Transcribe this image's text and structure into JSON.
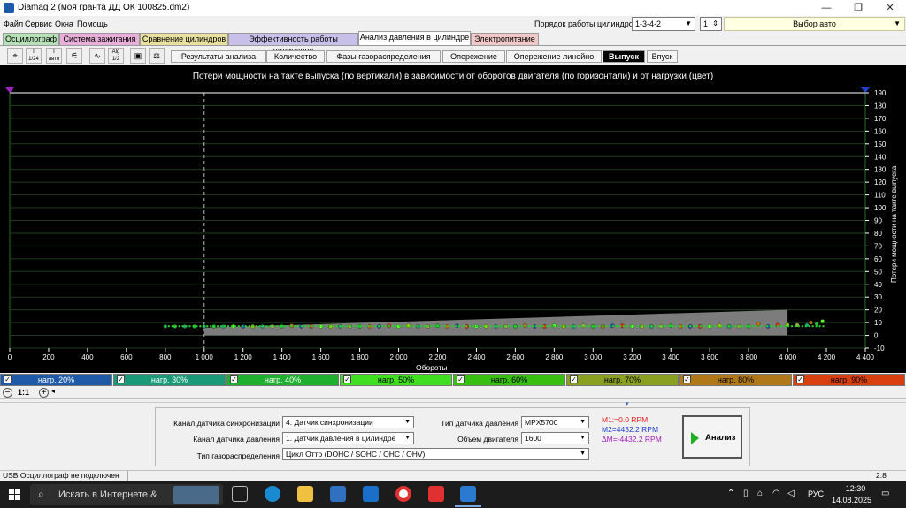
{
  "window": {
    "title": "Diamag 2 (моя гранта ДД ОК 100825.dm2)",
    "minimize": "—",
    "maximize": "❐",
    "close": "✕"
  },
  "menu": [
    "Файл",
    "Сервис",
    "Окна",
    "Помощь"
  ],
  "cylinder_order": {
    "label": "Порядок работы цилиндров",
    "value": "1-3-4-2",
    "cyl": "1"
  },
  "auto_select": "Выбор авто",
  "main_tabs": [
    {
      "label": "Осциллограф",
      "color": "#b8e0b8"
    },
    {
      "label": "Система зажигания",
      "color": "#e8b0d8"
    },
    {
      "label": "Сравнение цилиндров",
      "color": "#e8e0a0"
    },
    {
      "label": "Эффективность работы цилиндров",
      "color": "#c8c0e8"
    },
    {
      "label": "Анализ давления в цилиндре",
      "color": "#ffffff"
    },
    {
      "label": "Электропитание",
      "color": "#f0c8c8"
    }
  ],
  "sub_tabs": [
    "Результаты анализа",
    "Количество",
    "Фазы газораспределения",
    "Опережение",
    "Опережение линейно",
    "Выпуск",
    "Впуск"
  ],
  "sub_tab_active": "Выпуск",
  "chart_data": {
    "type": "scatter",
    "title": "Потери мощности на такте выпуска (по вертикали) в зависимости от оборотов двигателя (по горизонтали) и от нагрузки (цвет)",
    "xlabel": "Обороты",
    "ylabel": "Потери мощности на такте выпуска",
    "xlim": [
      0,
      4400
    ],
    "ylim": [
      -10,
      190
    ],
    "x_ticks": [
      "0",
      "200",
      "400",
      "600",
      "800",
      "1 000",
      "1 200",
      "1 400",
      "1 600",
      "1 800",
      "2 000",
      "2 200",
      "2 400",
      "2 600",
      "2 800",
      "3 000",
      "3 200",
      "3 400",
      "3 600",
      "3 800",
      "4 000",
      "4 200",
      "4 400"
    ],
    "y_ticks": [
      "-10",
      "0",
      "10",
      "20",
      "30",
      "40",
      "50",
      "60",
      "70",
      "80",
      "90",
      "100",
      "110",
      "120",
      "130",
      "140",
      "150",
      "160",
      "170",
      "180",
      "190"
    ],
    "cursor_x": 1000,
    "band": {
      "x": [
        1000,
        4000
      ],
      "y_low": [
        0,
        0
      ],
      "y_high": [
        6,
        20
      ],
      "color": "#8a8a8a"
    },
    "series": [
      {
        "name": "нагр. 20%",
        "color": "#1e5aa8",
        "x": [
          1200,
          1500,
          1900,
          2300,
          2700,
          3100,
          3500,
          3900
        ],
        "y": [
          7,
          7,
          7,
          7.5,
          7,
          7.5,
          7,
          7
        ]
      },
      {
        "name": "нагр. 30%",
        "color": "#20a070",
        "x": [
          800,
          900,
          1000,
          1100,
          1300,
          1700,
          2100,
          2500,
          2900,
          3300,
          3700,
          4100
        ],
        "y": [
          7,
          7,
          7,
          7,
          7,
          7,
          7,
          7,
          7,
          7,
          7,
          8
        ]
      },
      {
        "name": "нагр. 40%",
        "color": "#20c030",
        "x": [
          850,
          950,
          1050,
          1400,
          1800,
          2200,
          2600,
          3000,
          3400,
          3800,
          4150
        ],
        "y": [
          7,
          7,
          7,
          7,
          7,
          7.5,
          7,
          7,
          7.5,
          7,
          9
        ]
      },
      {
        "name": "нагр. 50%",
        "color": "#60ff30",
        "x": [
          1150,
          1600,
          2000,
          2400,
          2800,
          3200,
          3600,
          4180
        ],
        "y": [
          7,
          7,
          7,
          7,
          7.5,
          7,
          7,
          11
        ]
      },
      {
        "name": "нагр. 60%",
        "color": "#a0d000",
        "x": [
          1250,
          1650,
          2050,
          2450,
          2850,
          3250,
          3650,
          4000
        ],
        "y": [
          7,
          7,
          7.5,
          7,
          7,
          7,
          7.5,
          8
        ]
      },
      {
        "name": "нагр. 70%",
        "color": "#a0b040",
        "x": [
          1350,
          1750,
          2150,
          2550,
          2950,
          3350,
          3750,
          4050
        ],
        "y": [
          7,
          7,
          7,
          7,
          7.5,
          7,
          7,
          8
        ]
      },
      {
        "name": "нагр. 80%",
        "color": "#c07010",
        "x": [
          1450,
          1850,
          2250,
          2650,
          3050,
          3450,
          3850,
          4120
        ],
        "y": [
          7.5,
          7,
          7,
          7.5,
          7,
          7,
          9,
          10
        ]
      },
      {
        "name": "нагр. 90%",
        "color": "#e03010",
        "x": [
          1550,
          1950,
          2350,
          2750,
          3150,
          3550,
          3950
        ],
        "y": [
          7,
          7.5,
          7,
          7,
          7.5,
          7,
          8
        ]
      }
    ]
  },
  "loads": [
    {
      "label": "нагр. 20%",
      "color": "#1e5aa8",
      "text_color": "#ffffff"
    },
    {
      "label": "нагр. 30%",
      "color": "#1a9a78",
      "text_color": "#ffffff"
    },
    {
      "label": "нагр. 40%",
      "color": "#20b030",
      "text_color": "#ffffff"
    },
    {
      "label": "нагр. 50%",
      "color": "#40e020",
      "text_color": "#000000"
    },
    {
      "label": "нагр. 60%",
      "color": "#38c010",
      "text_color": "#000000"
    },
    {
      "label": "нагр. 70%",
      "color": "#8aa020",
      "text_color": "#000000"
    },
    {
      "label": "нагр. 80%",
      "color": "#b07818",
      "text_color": "#000000"
    },
    {
      "label": "нагр. 90%",
      "color": "#d84010",
      "text_color": "#000000"
    }
  ],
  "zoom": "1:1",
  "settings": {
    "sync_label": "Канал датчика синхронизации",
    "sync_value": "4.  Датчик синхронизации",
    "press_label": "Канал датчика давления",
    "press_value": "1.  Датчик давления в цилиндре",
    "gas_label": "Тип газораспределения",
    "gas_value": "Цикл Отто (DOHC / SOHC / OHC / OHV)",
    "sensor_label": "Тип датчика давления",
    "sensor_value": "MPX5700",
    "volume_label": "Объем двигателя",
    "volume_value": "1600",
    "m1": "M1:=0.0 RPM",
    "m2": "M2=4432.2 RPM",
    "dm": "ΔM=-4432.2 RPM",
    "analyze": "Анализ"
  },
  "status": {
    "left": "USB Осциллограф не подключен",
    "right": "2.8"
  },
  "taskbar": {
    "search": "Искать в Интернете &",
    "lang": "РУС",
    "time": "12:30",
    "date": "14.08.2025"
  }
}
